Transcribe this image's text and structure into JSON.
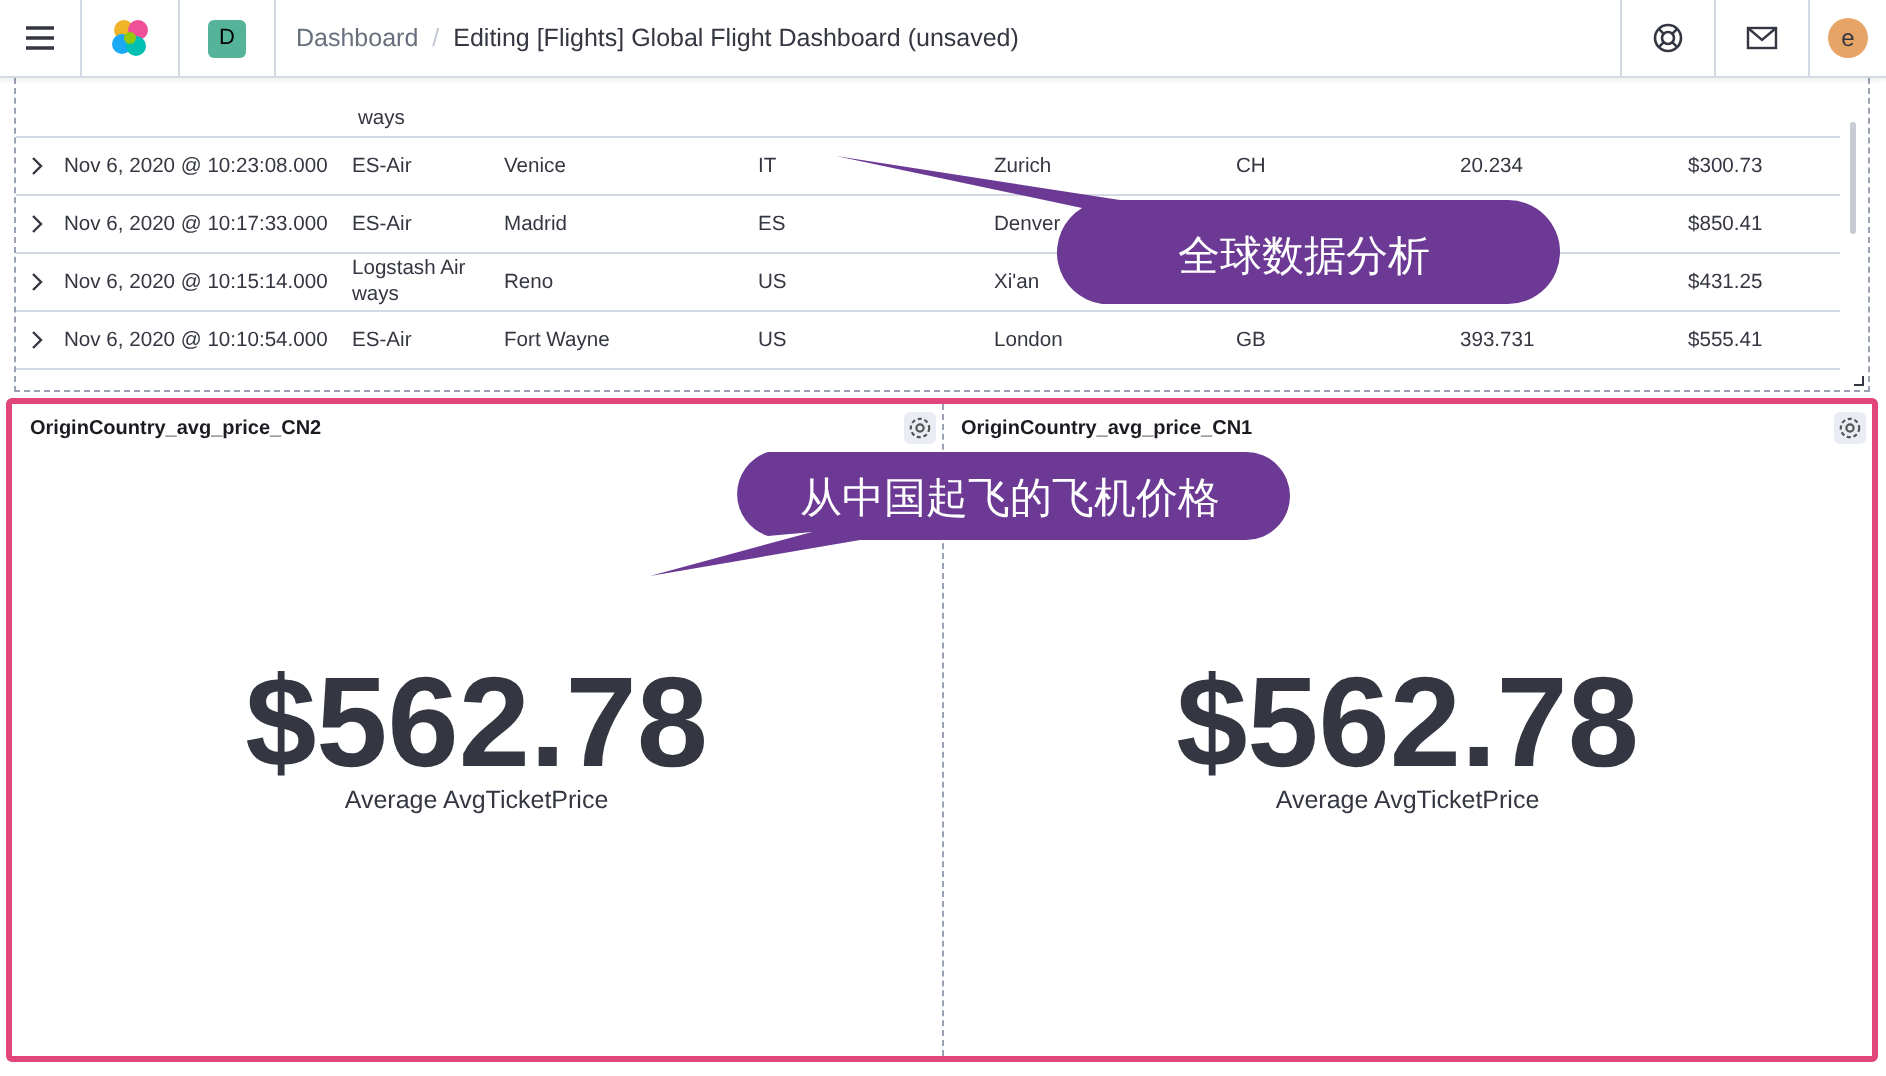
{
  "header": {
    "space_badge": "D",
    "breadcrumb_separator": "/",
    "breadcrumbs": [
      {
        "label": "Dashboard",
        "kind": "link"
      },
      {
        "label": "Editing [Flights] Global Flight Dashboard (unsaved)",
        "kind": "current"
      }
    ],
    "avatar": "e"
  },
  "table": {
    "rows": [
      {
        "kind": "partial",
        "column_3": "ways"
      },
      {
        "kind": "full",
        "column_2": "Nov 6, 2020 @ 10:23:08.000",
        "column_3": "ES-Air",
        "column_4": "Venice",
        "column_5": "IT",
        "column_6": "Zurich",
        "column_7": "CH",
        "column_8": "20.234",
        "column_9": "$300.73"
      },
      {
        "kind": "full",
        "column_2": "Nov 6, 2020 @ 10:17:33.000",
        "column_3": "ES-Air",
        "column_4": "Madrid",
        "column_5": "ES",
        "column_6": "Denver",
        "column_9": "$850.41"
      },
      {
        "kind": "full",
        "column_2": "Nov 6, 2020 @ 10:15:14.000",
        "column_3": "Logstash Airways",
        "column_4": "Reno",
        "column_5": "US",
        "column_6": "Xi'an",
        "column_9": "$431.25"
      },
      {
        "kind": "full",
        "column_2": "Nov 6, 2020 @ 10:10:54.000",
        "column_3": "ES-Air",
        "column_4": "Fort Wayne",
        "column_5": "US",
        "column_6": "London",
        "column_7": "GB",
        "column_8": "393.731",
        "column_9": "$555.41"
      }
    ]
  },
  "metric_panels": [
    {
      "title": "OriginCountry_avg_price_CN2",
      "value": "$562.78",
      "label": "Average AvgTicketPrice"
    },
    {
      "title": "OriginCountry_avg_price_CN1",
      "value": "$562.78",
      "label": "Average AvgTicketPrice"
    }
  ],
  "callouts": [
    {
      "text": "全球数据分析"
    },
    {
      "text": "从中国起飞的飞机价格"
    }
  ]
}
